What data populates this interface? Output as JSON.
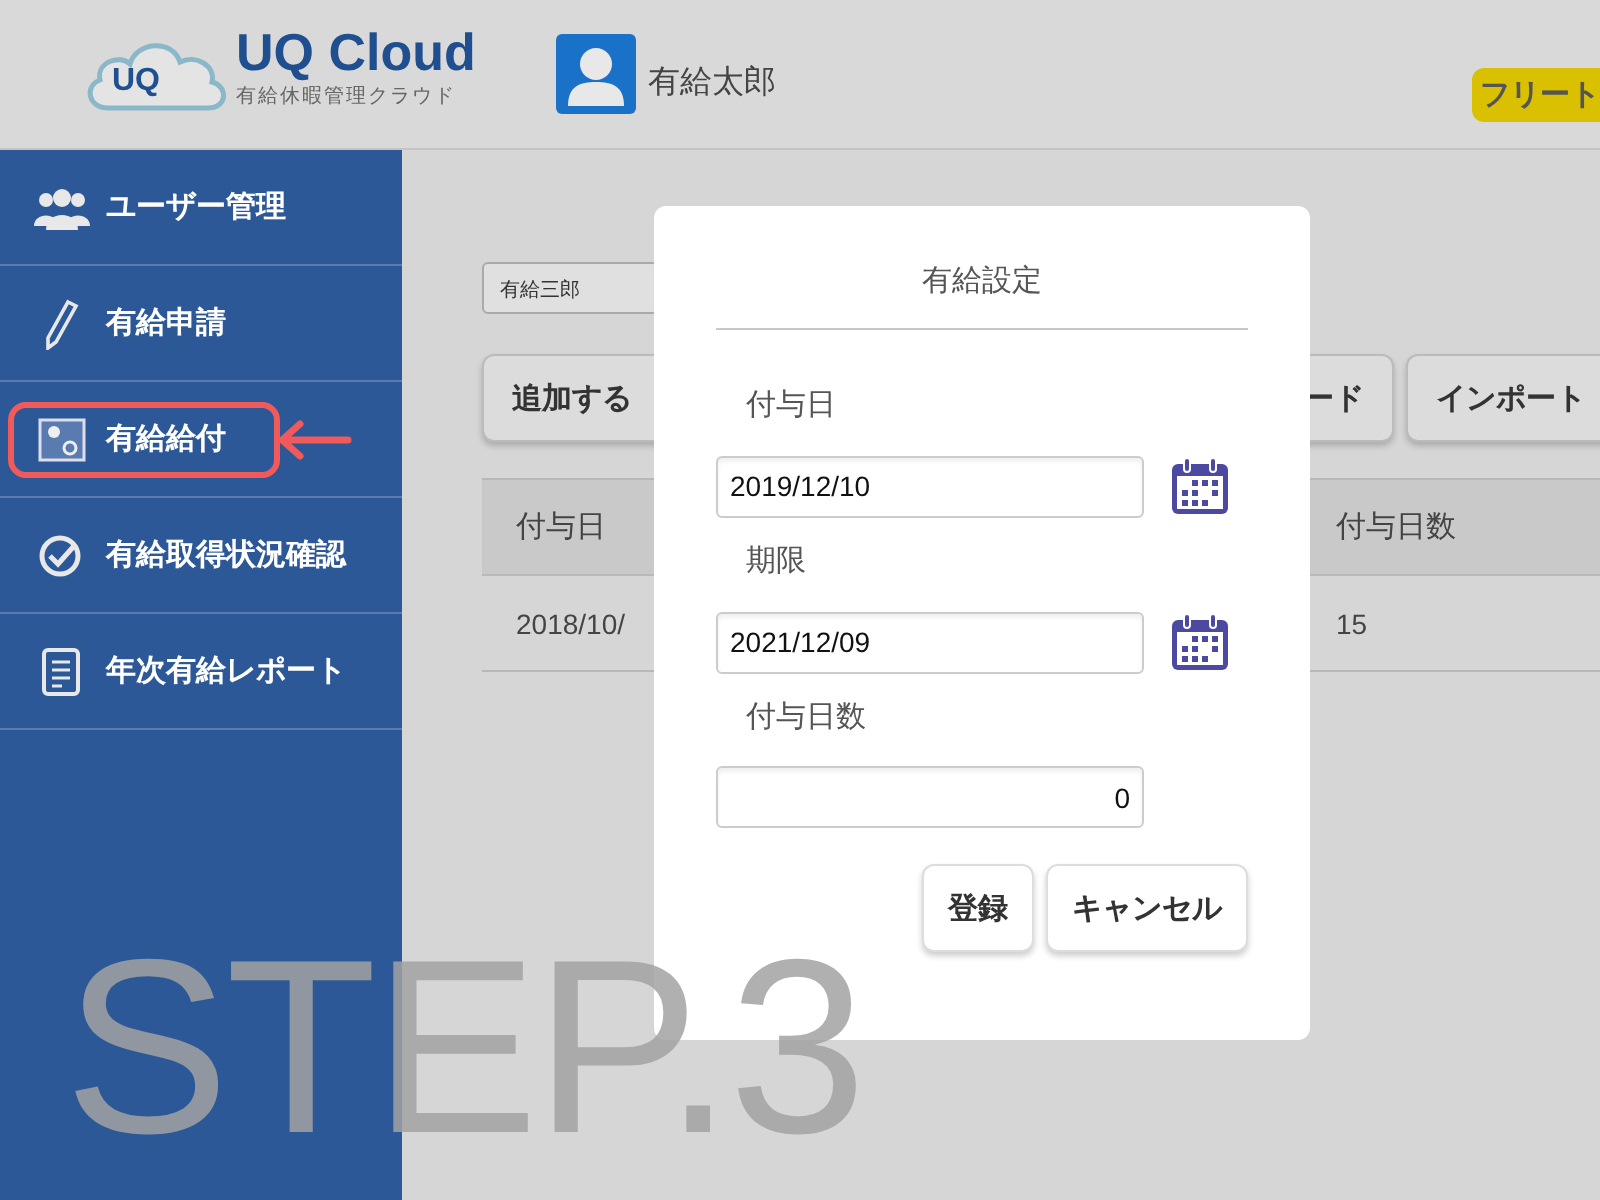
{
  "header": {
    "logo": {
      "mark": "UQ",
      "title": "UQ Cloud",
      "subtitle": "有給休暇管理クラウド"
    },
    "user_name": "有給太郎",
    "badge": "フリート"
  },
  "sidebar": {
    "items": [
      {
        "label": "ユーザー管理",
        "kind": "users",
        "highlighted": false
      },
      {
        "label": "有給申請",
        "kind": "pencil",
        "highlighted": false
      },
      {
        "label": "有給給付",
        "kind": "image",
        "highlighted": true
      },
      {
        "label": "有給取得状況確認",
        "kind": "check",
        "highlighted": false
      },
      {
        "label": "年次有給レポート",
        "kind": "document",
        "highlighted": false
      }
    ]
  },
  "main": {
    "employee_select": "有給三郎",
    "buttons": [
      "追加する",
      "ード",
      "インポート"
    ],
    "table": {
      "columns": [
        "付与日",
        "付与日数"
      ],
      "rows": [
        [
          "2018/10/",
          "15"
        ]
      ]
    }
  },
  "dialog": {
    "title": "有給設定",
    "fields": [
      {
        "label": "付与日",
        "value": "2019/12/10",
        "kind": "date"
      },
      {
        "label": "期限",
        "value": "2021/12/09",
        "kind": "date"
      },
      {
        "label": "付与日数",
        "value": "0",
        "kind": "number"
      }
    ],
    "buttons": [
      "登録",
      "キャンセル"
    ]
  },
  "step_label": "STEP.3"
}
